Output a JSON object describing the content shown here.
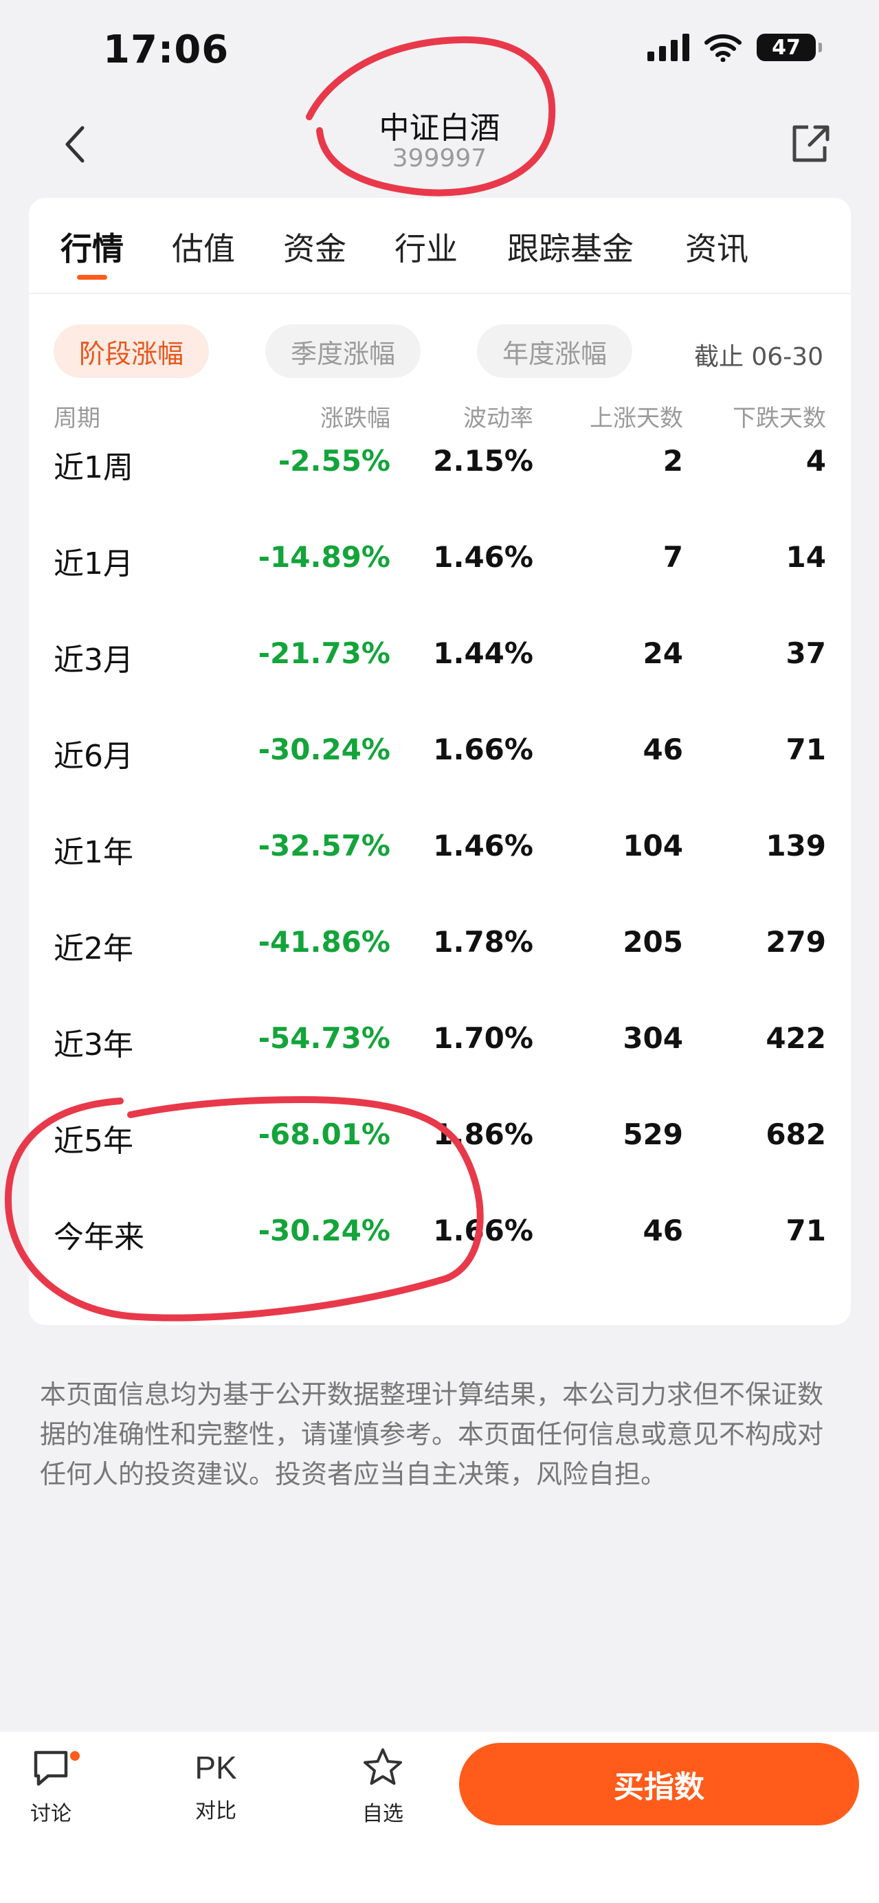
{
  "status": {
    "time": "17:06",
    "battery": "47"
  },
  "nav": {
    "title": "中证白酒",
    "code": "399997"
  },
  "tabs": [
    "行情",
    "估值",
    "资金",
    "行业",
    "跟踪基金",
    "资讯"
  ],
  "filters": {
    "chips": [
      "阶段涨幅",
      "季度涨幅",
      "年度涨幅"
    ],
    "as_of": "截止 06-30"
  },
  "table": {
    "headers": [
      "周期",
      "涨跌幅",
      "波动率",
      "上涨天数",
      "下跌天数"
    ],
    "rows": [
      {
        "period": "近1周",
        "change": "-2.55%",
        "volatility": "2.15%",
        "up_days": "2",
        "down_days": "4"
      },
      {
        "period": "近1月",
        "change": "-14.89%",
        "volatility": "1.46%",
        "up_days": "7",
        "down_days": "14"
      },
      {
        "period": "近3月",
        "change": "-21.73%",
        "volatility": "1.44%",
        "up_days": "24",
        "down_days": "37"
      },
      {
        "period": "近6月",
        "change": "-30.24%",
        "volatility": "1.66%",
        "up_days": "46",
        "down_days": "71"
      },
      {
        "period": "近1年",
        "change": "-32.57%",
        "volatility": "1.46%",
        "up_days": "104",
        "down_days": "139"
      },
      {
        "period": "近2年",
        "change": "-41.86%",
        "volatility": "1.78%",
        "up_days": "205",
        "down_days": "279"
      },
      {
        "period": "近3年",
        "change": "-54.73%",
        "volatility": "1.70%",
        "up_days": "304",
        "down_days": "422"
      },
      {
        "period": "近5年",
        "change": "-68.01%",
        "volatility": "1.86%",
        "up_days": "529",
        "down_days": "682"
      },
      {
        "period": "今年来",
        "change": "-30.24%",
        "volatility": "1.66%",
        "up_days": "46",
        "down_days": "71"
      }
    ]
  },
  "disclaimer": "本页面信息均为基于公开数据整理计算结果，本公司力求但不保证数据的准确性和完整性，请谨慎参考。本页面任何信息或意见不构成对任何人的投资建议。投资者应当自主决策，风险自担。",
  "bottom_bar": {
    "discuss_label": "讨论",
    "pk_text": "PK",
    "compare_label": "对比",
    "watchlist_label": "自选",
    "buy_label": "买指数"
  },
  "colors": {
    "accent": "#ff5b1a",
    "down": "#13a43a",
    "annotation": "#e8394a"
  },
  "icons": [
    "signal-icon",
    "wifi-icon",
    "battery-icon",
    "back-icon",
    "share-icon",
    "chat-icon",
    "star-icon"
  ]
}
